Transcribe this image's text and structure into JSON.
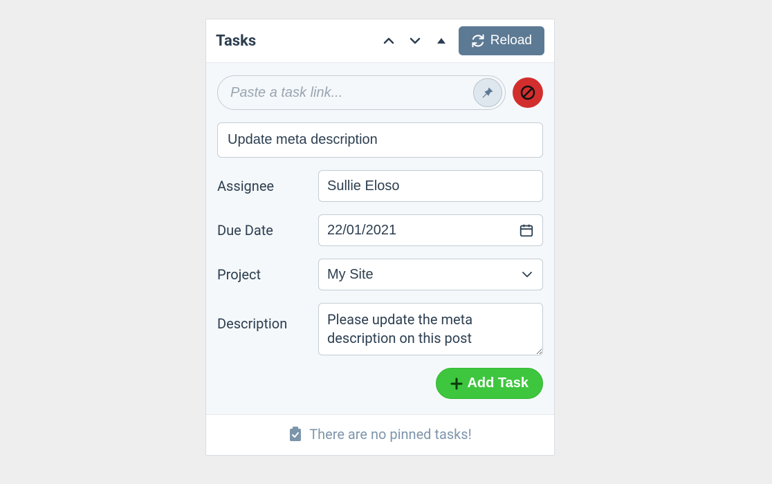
{
  "header": {
    "title": "Tasks",
    "reload_label": "Reload"
  },
  "search": {
    "placeholder": "Paste a task link..."
  },
  "form": {
    "title_value": "Update meta description",
    "assignee_label": "Assignee",
    "assignee_value": "Sullie Eloso",
    "duedate_label": "Due Date",
    "duedate_value": "22/01/2021",
    "project_label": "Project",
    "project_value": "My Site",
    "description_label": "Description",
    "description_value": "Please update the meta description on this post",
    "add_task_label": "Add Task"
  },
  "footer": {
    "empty_text": "There are no pinned tasks!"
  }
}
